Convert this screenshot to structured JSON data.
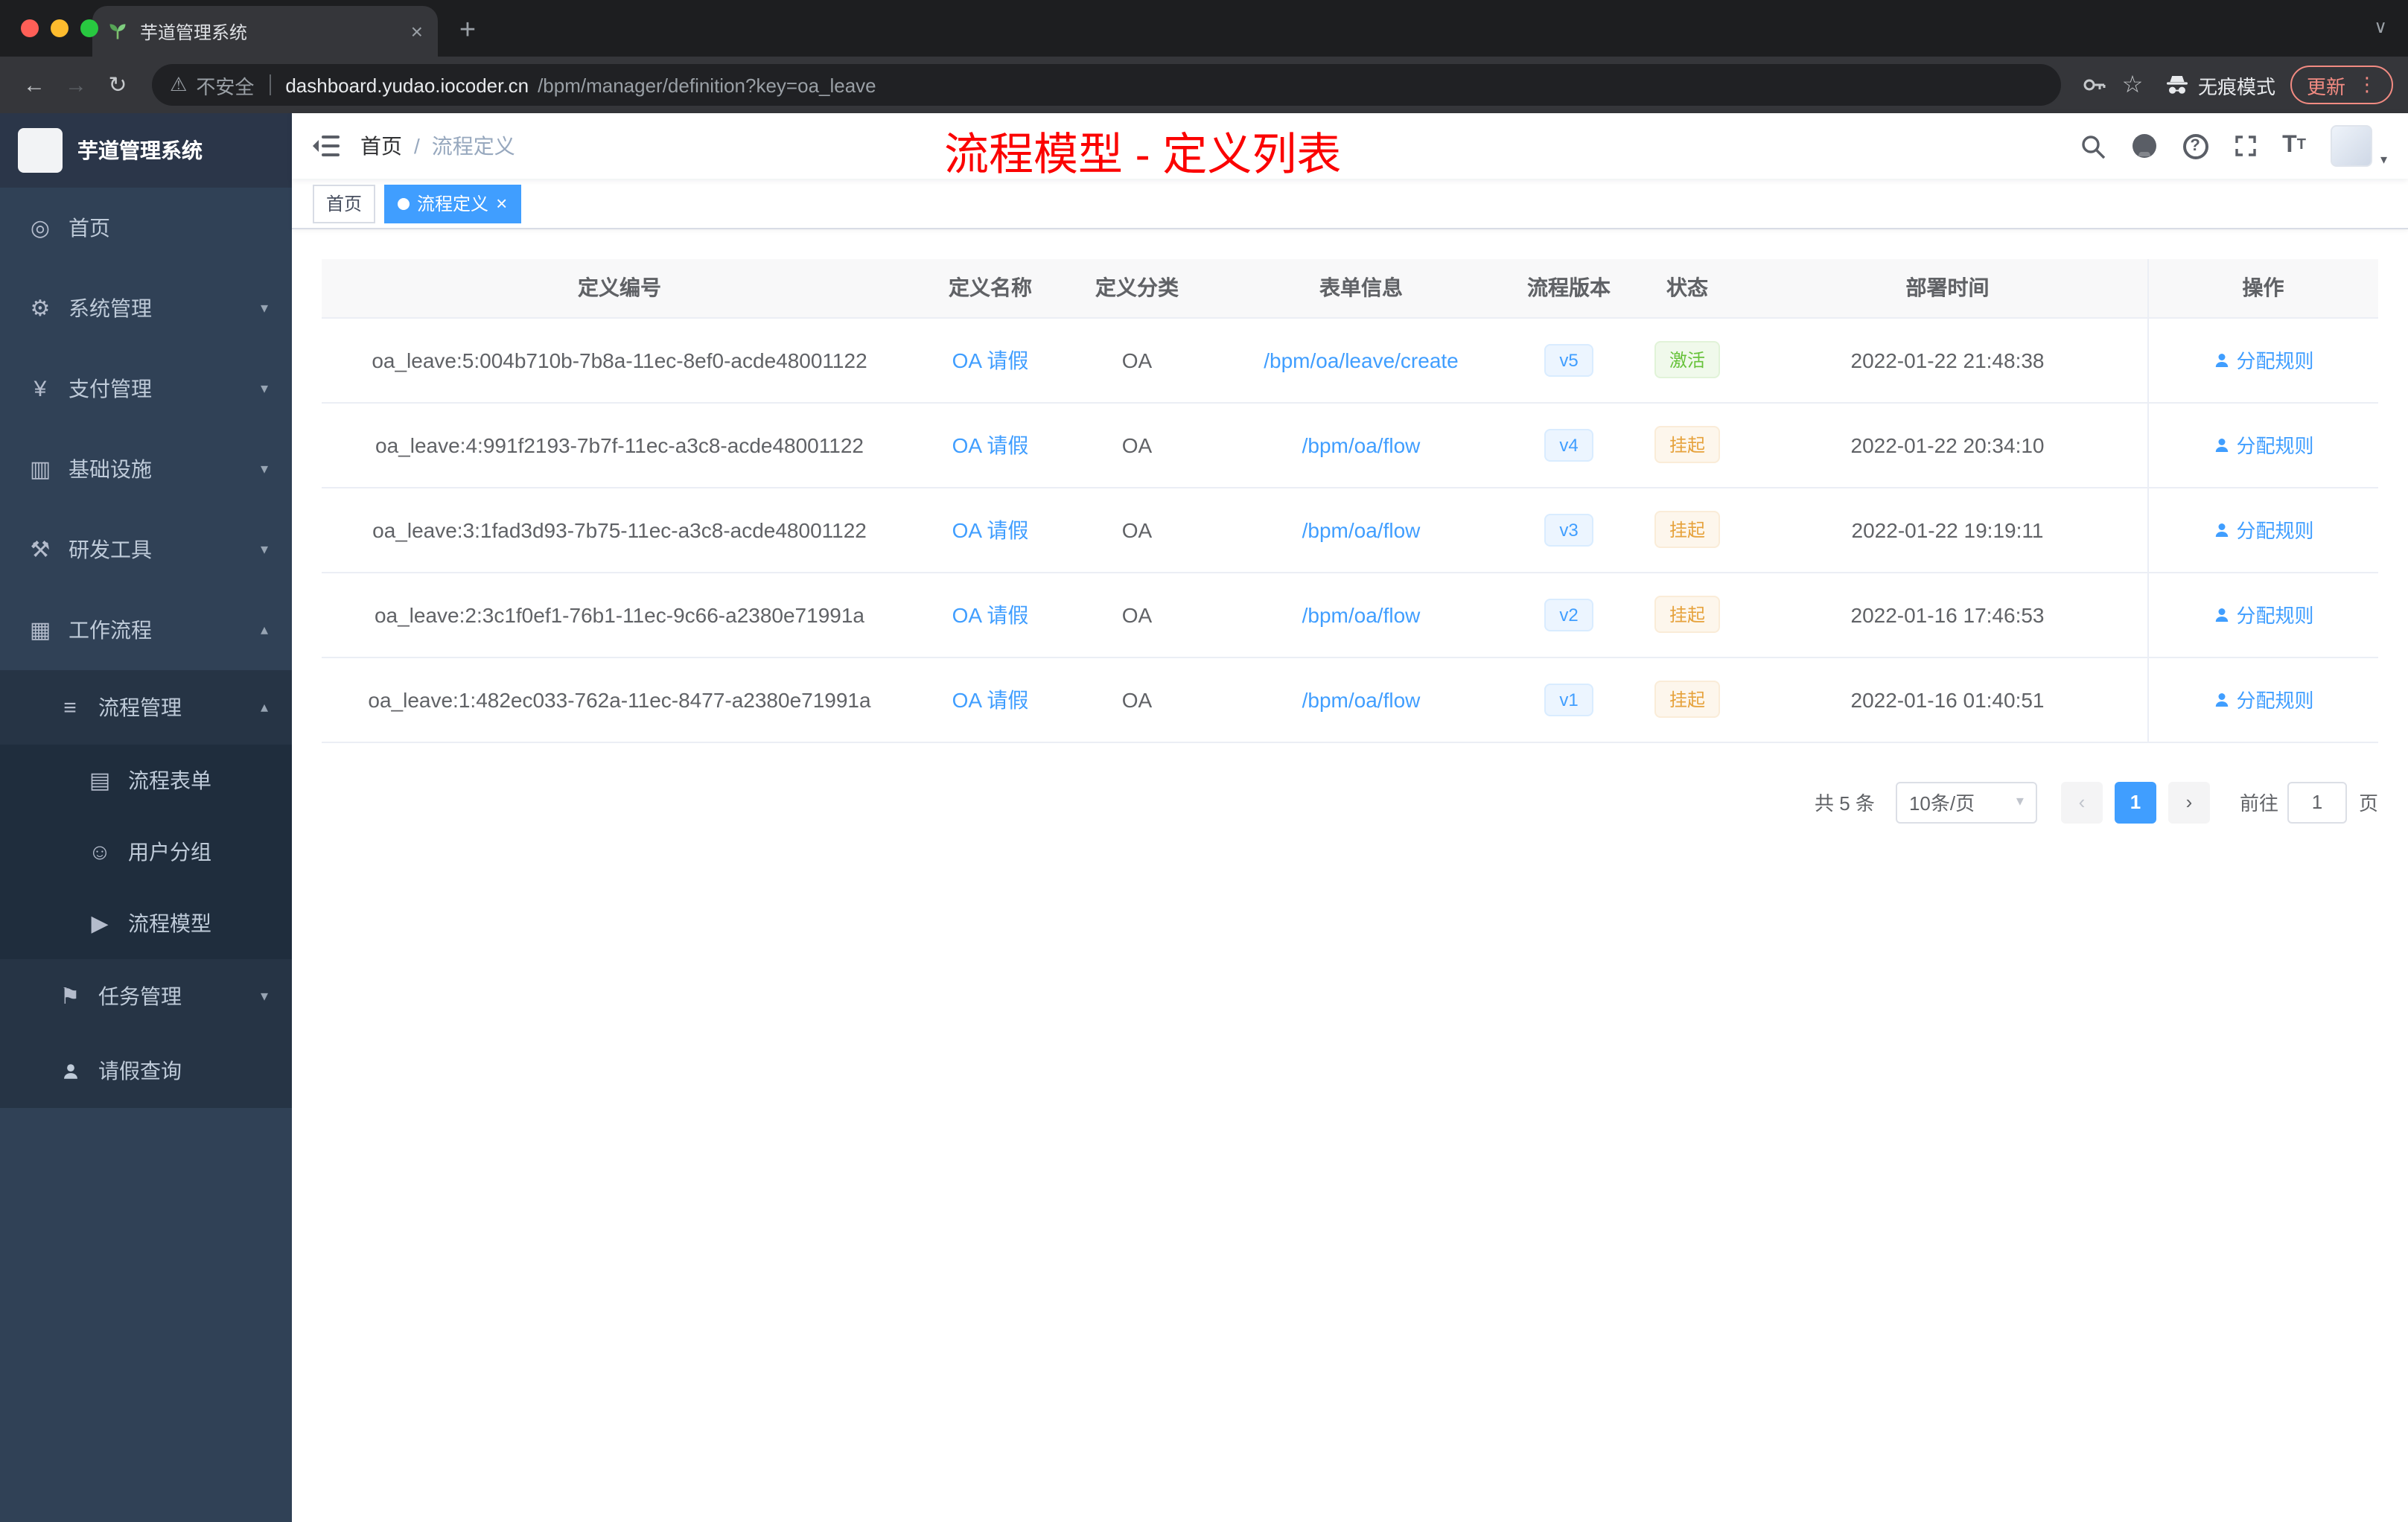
{
  "colors": {
    "accent": "#409eff",
    "success": "#67c23a",
    "warning": "#e6a23c",
    "annotation_red": "#fb0200",
    "sidebar_bg": "#304156"
  },
  "browser": {
    "tab_title": "芋道管理系统",
    "not_secure": "不安全",
    "url_host": "dashboard.yudao.iocoder.cn",
    "url_path": "/bpm/manager/definition?key=oa_leave",
    "incognito_label": "无痕模式",
    "update_label": "更新"
  },
  "sidebar": {
    "title": "芋道管理系统",
    "home": "首页",
    "system": "系统管理",
    "payment": "支付管理",
    "infra": "基础设施",
    "devtools": "研发工具",
    "workflow": "工作流程",
    "process_mgmt": "流程管理",
    "process_form": "流程表单",
    "user_group": "用户分组",
    "process_model": "流程模型",
    "task_mgmt": "任务管理",
    "leave_query": "请假查询"
  },
  "header": {
    "breadcrumb_home": "首页",
    "breadcrumb_sep": "/",
    "breadcrumb_current": "流程定义",
    "annotation": "流程模型 - 定义列表"
  },
  "tags": {
    "home": "首页",
    "current": "流程定义"
  },
  "table": {
    "columns": [
      "定义编号",
      "定义名称",
      "定义分类",
      "表单信息",
      "流程版本",
      "状态",
      "部署时间",
      "操作"
    ],
    "rows": [
      {
        "id": "oa_leave:5:004b710b-7b8a-11ec-8ef0-acde48001122",
        "name": "OA 请假",
        "category": "OA",
        "form": "/bpm/oa/leave/create",
        "version": "v5",
        "status": "激活",
        "time": "2022-01-22 21:48:38",
        "action": "分配规则"
      },
      {
        "id": "oa_leave:4:991f2193-7b7f-11ec-a3c8-acde48001122",
        "name": "OA 请假",
        "category": "OA",
        "form": "/bpm/oa/flow",
        "version": "v4",
        "status": "挂起",
        "time": "2022-01-22 20:34:10",
        "action": "分配规则"
      },
      {
        "id": "oa_leave:3:1fad3d93-7b75-11ec-a3c8-acde48001122",
        "name": "OA 请假",
        "category": "OA",
        "form": "/bpm/oa/flow",
        "version": "v3",
        "status": "挂起",
        "time": "2022-01-22 19:19:11",
        "action": "分配规则"
      },
      {
        "id": "oa_leave:2:3c1f0ef1-76b1-11ec-9c66-a2380e71991a",
        "name": "OA 请假",
        "category": "OA",
        "form": "/bpm/oa/flow",
        "version": "v2",
        "status": "挂起",
        "time": "2022-01-16 17:46:53",
        "action": "分配规则"
      },
      {
        "id": "oa_leave:1:482ec033-762a-11ec-8477-a2380e71991a",
        "name": "OA 请假",
        "category": "OA",
        "form": "/bpm/oa/flow",
        "version": "v1",
        "status": "挂起",
        "time": "2022-01-16 01:40:51",
        "action": "分配规则"
      }
    ]
  },
  "pagination": {
    "total": "共 5 条",
    "page_size": "10条/页",
    "page": "1",
    "goto_label": "前往",
    "goto_value": "1",
    "unit": "页"
  },
  "icons": {
    "back": "←",
    "forward": "→",
    "reload": "↻",
    "warning": "⚠",
    "star": "☆",
    "menu_dots": "⋮",
    "tab_chevron": "∨",
    "new_tab": "+",
    "tab_close": "×",
    "dashboard": "◎",
    "gear": "⚙",
    "yen": "¥",
    "infra": "▥",
    "tools": "⚒",
    "workflow": "▦",
    "process": "≡",
    "form": "▤",
    "users": "☺",
    "model": "▶",
    "task": "⚑",
    "chev_down": "▾",
    "chev_up": "▴",
    "question": "?",
    "caret": "▾",
    "prev": "‹",
    "next": "›",
    "font_big": "T",
    "font_small": "T"
  }
}
